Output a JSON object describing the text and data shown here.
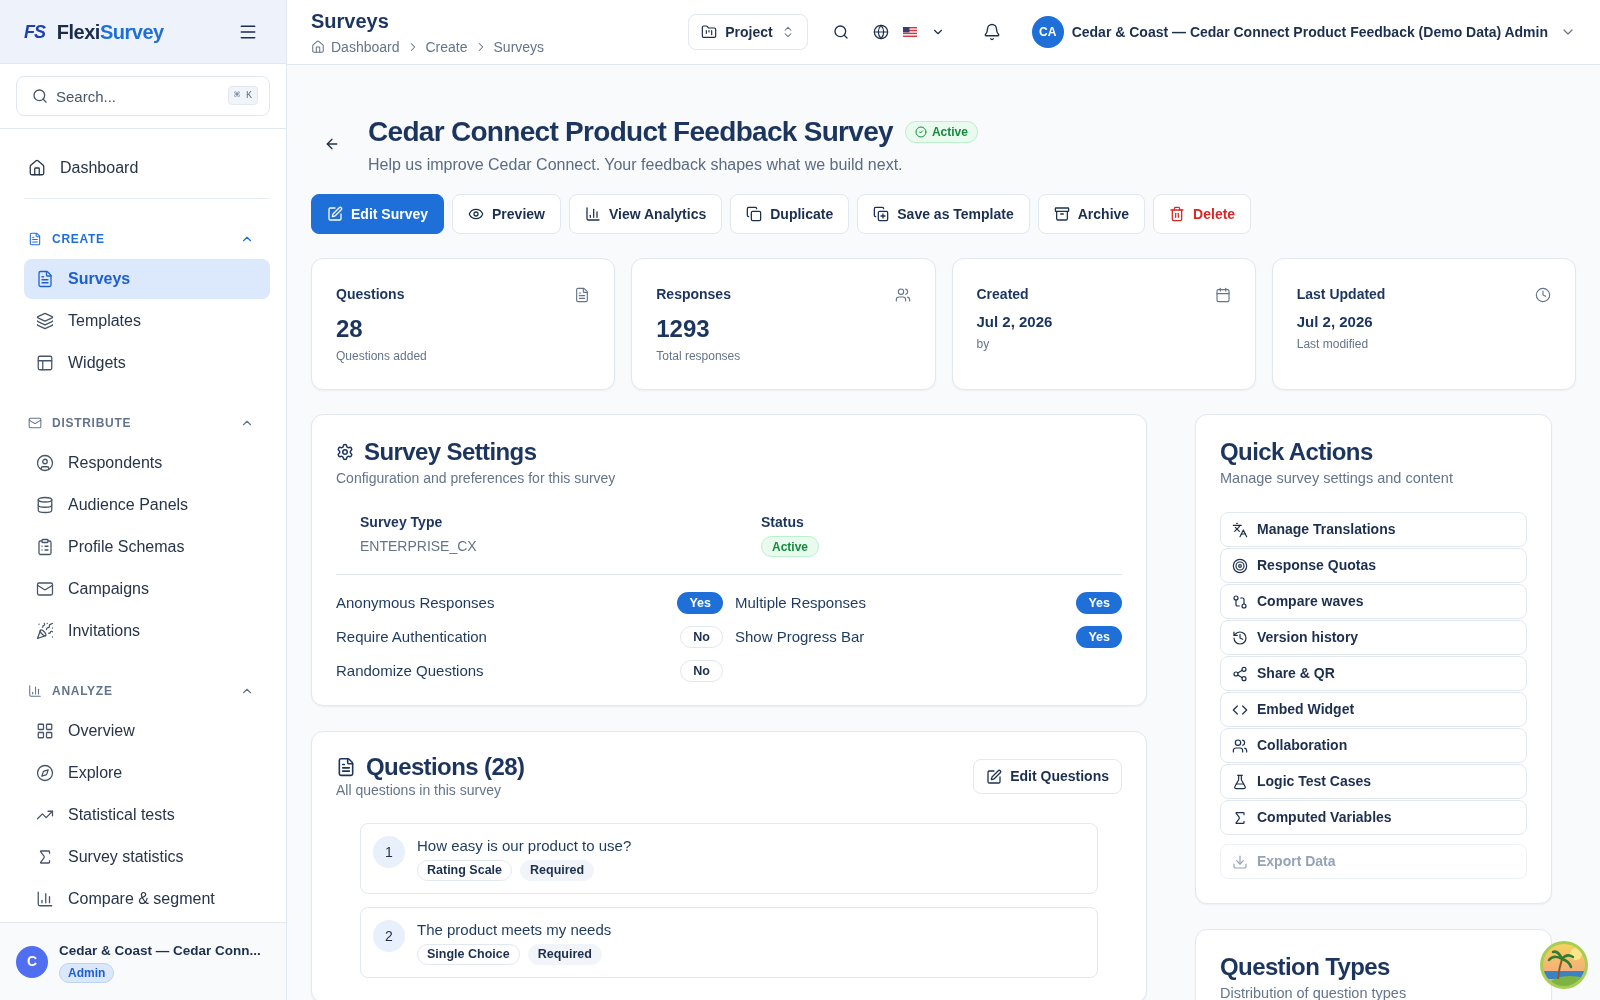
{
  "sidebar": {
    "brand": {
      "mark": "FS",
      "name_parts": [
        "Flexi",
        "Survey"
      ]
    },
    "search": {
      "placeholder": "Search...",
      "shortcut": "⌘ K"
    },
    "dashboard": {
      "label": "Dashboard",
      "selected": false
    },
    "sections": [
      {
        "title": "CREATE",
        "expanded": true,
        "items": [
          {
            "label": "Surveys",
            "selected": true
          },
          {
            "label": "Templates",
            "selected": false
          },
          {
            "label": "Widgets",
            "selected": false
          }
        ]
      },
      {
        "title": "DISTRIBUTE",
        "expanded": true,
        "items": [
          {
            "label": "Respondents",
            "selected": false
          },
          {
            "label": "Audience Panels",
            "selected": false
          },
          {
            "label": "Profile Schemas",
            "selected": false
          },
          {
            "label": "Campaigns",
            "selected": false
          },
          {
            "label": "Invitations",
            "selected": false
          }
        ]
      },
      {
        "title": "ANALYZE",
        "expanded": true,
        "items": [
          {
            "label": "Overview",
            "selected": false
          },
          {
            "label": "Explore",
            "selected": false
          },
          {
            "label": "Statistical tests",
            "selected": false
          },
          {
            "label": "Survey statistics",
            "selected": false
          },
          {
            "label": "Compare & segment",
            "selected": false
          }
        ]
      }
    ],
    "user": {
      "initial": "C",
      "name": "Cedar & Coast — Cedar Conn...",
      "role": "Admin"
    }
  },
  "header": {
    "title": "Surveys",
    "breadcrumb": [
      "Dashboard",
      "Create",
      "Surveys"
    ],
    "project_button": "Project",
    "user": {
      "initials": "CA",
      "name": "Cedar & Coast — Cedar Connect Product Feedback (Demo Data) Admin"
    }
  },
  "survey": {
    "title": "Cedar Connect Product Feedback Survey",
    "status": "Active",
    "description": "Help us improve Cedar Connect. Your feedback shapes what we build next."
  },
  "actions": [
    {
      "label": "Edit Survey",
      "kind": "primary"
    },
    {
      "label": "Preview",
      "kind": "default"
    },
    {
      "label": "View Analytics",
      "kind": "default"
    },
    {
      "label": "Duplicate",
      "kind": "default"
    },
    {
      "label": "Save as Template",
      "kind": "default"
    },
    {
      "label": "Archive",
      "kind": "default"
    },
    {
      "label": "Delete",
      "kind": "danger"
    }
  ],
  "stats": [
    {
      "label": "Questions",
      "value": "28",
      "caption": "Questions added",
      "kind": "count"
    },
    {
      "label": "Responses",
      "value": "1293",
      "caption": "Total responses",
      "kind": "count"
    },
    {
      "label": "Created",
      "value": "Jul 2, 2026",
      "caption": "by",
      "kind": "date"
    },
    {
      "label": "Last Updated",
      "value": "Jul 2, 2026",
      "caption": "Last modified",
      "kind": "date"
    }
  ],
  "settings": {
    "title": "Survey Settings",
    "description": "Configuration and preferences for this survey",
    "survey_type": {
      "label": "Survey Type",
      "value": "ENTERPRISE_CX"
    },
    "status": {
      "label": "Status",
      "value": "Active"
    },
    "options": [
      {
        "label": "Anonymous Responses",
        "value": "Yes",
        "on": true
      },
      {
        "label": "Multiple Responses",
        "value": "Yes",
        "on": true
      },
      {
        "label": "Require Authentication",
        "value": "No",
        "on": false
      },
      {
        "label": "Show Progress Bar",
        "value": "Yes",
        "on": true
      },
      {
        "label": "Randomize Questions",
        "value": "No",
        "on": false
      }
    ]
  },
  "questions": {
    "title": "Questions (28)",
    "description": "All questions in this survey",
    "edit_button": "Edit Questions",
    "items": [
      {
        "number": "1",
        "text": "How easy is our product to use?",
        "tags": [
          {
            "label": "Rating Scale",
            "kind": "type"
          },
          {
            "label": "Required",
            "kind": "required"
          }
        ]
      },
      {
        "number": "2",
        "text": "The product meets my needs",
        "tags": [
          {
            "label": "Single Choice",
            "kind": "type"
          },
          {
            "label": "Required",
            "kind": "required"
          }
        ]
      }
    ]
  },
  "quick_actions": {
    "title": "Quick Actions",
    "description": "Manage survey settings and content",
    "items": [
      {
        "label": "Manage Translations",
        "disabled": false
      },
      {
        "label": "Response Quotas",
        "disabled": false
      },
      {
        "label": "Compare waves",
        "disabled": false
      },
      {
        "label": "Version history",
        "disabled": false
      },
      {
        "label": "Share & QR",
        "disabled": false
      },
      {
        "label": "Embed Widget",
        "disabled": false
      },
      {
        "label": "Collaboration",
        "disabled": false
      },
      {
        "label": "Logic Test Cases",
        "disabled": false
      },
      {
        "label": "Computed Variables",
        "disabled": false
      }
    ],
    "export_button": {
      "label": "Export Data",
      "disabled": true
    }
  },
  "question_types": {
    "title": "Question Types",
    "description": "Distribution of question types"
  }
}
